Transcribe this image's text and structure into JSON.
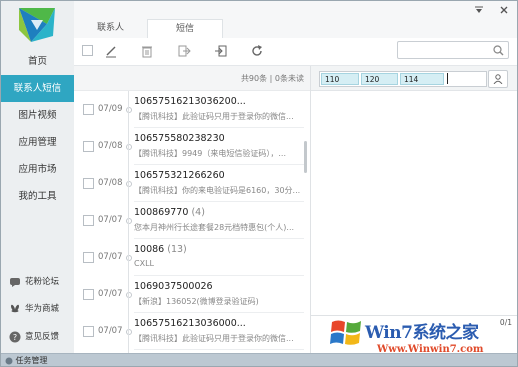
{
  "window": {
    "menu_icon": "menu-triangle-icon",
    "close_icon": "close-icon"
  },
  "sidebar": {
    "items": [
      {
        "label": "首页"
      },
      {
        "label": "联系人短信"
      },
      {
        "label": "图片视频"
      },
      {
        "label": "应用管理"
      },
      {
        "label": "应用市场"
      },
      {
        "label": "我的工具"
      }
    ],
    "active_index": 1,
    "bottom": [
      {
        "label": "花粉论坛",
        "icon": "forum-icon"
      },
      {
        "label": "华为商城",
        "icon": "huawei-icon"
      },
      {
        "label": "意见反馈",
        "icon": "help-icon"
      }
    ]
  },
  "tabs": [
    {
      "label": "联系人"
    },
    {
      "label": "短信"
    }
  ],
  "active_tab": 1,
  "toolbar": {
    "search_placeholder": ""
  },
  "list": {
    "summary": "共90条 | 0条未读",
    "messages": [
      {
        "date": "07/09",
        "number": "10657516213036200...",
        "count": "",
        "preview": "【腾讯科技】此验证码只用于登录你的微信..."
      },
      {
        "date": "07/08",
        "number": "106575580238230",
        "count": "",
        "preview": "【腾讯科技】9949（来电短信验证码），..."
      },
      {
        "date": "07/08",
        "number": "106575321266260",
        "count": "",
        "preview": "【腾讯科技】你的来电验证码是6160，30分..."
      },
      {
        "date": "07/07",
        "number": "100869770",
        "count": "(4)",
        "preview": "您本月神州行长途套餐28元档特惠包(个人)..."
      },
      {
        "date": "07/07",
        "number": "10086",
        "count": "(13)",
        "preview": "CXLL"
      },
      {
        "date": "07/07",
        "number": "1069037500026",
        "count": "",
        "preview": "【新浪】136052(微博登录验证码)"
      },
      {
        "date": "07/07",
        "number": "10657516213036000...",
        "count": "",
        "preview": "【腾讯科技】此验证码只用于登录你的微信..."
      }
    ]
  },
  "compose": {
    "recipients": [
      "110",
      "120",
      "114"
    ],
    "char_count": "0/1"
  },
  "taskbar": {
    "label": "任务管理"
  },
  "watermark": {
    "brand": "Win7系统之家",
    "url": "Www.Winwin7.com"
  },
  "colors": {
    "accent": "#2fa6c2",
    "sidebar_bg": "#eceff1",
    "chip": "#d5eef4"
  }
}
